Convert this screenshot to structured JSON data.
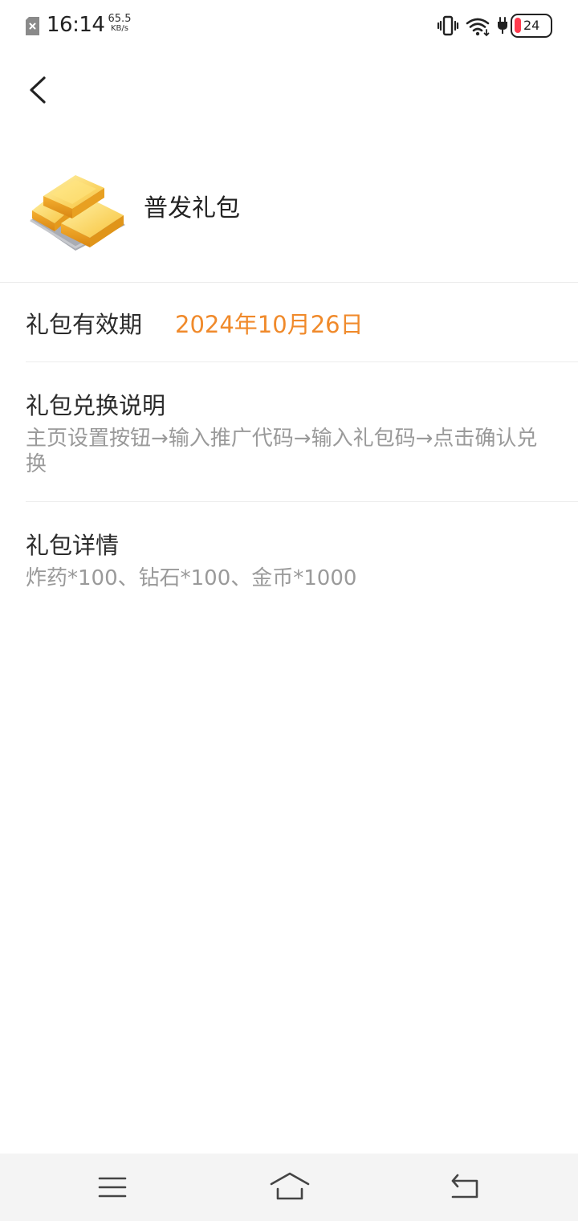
{
  "status_bar": {
    "time": "16:14",
    "net_speed_value": "65.5",
    "net_speed_unit": "KB/s",
    "battery_level": "24",
    "battery_color": "#ff3b4e"
  },
  "icons": {
    "sim": "sim-card-disabled-icon",
    "vibrate": "vibrate-icon",
    "wifi": "wifi-icon",
    "charging": "charging-plug-icon",
    "back": "chevron-left-icon",
    "gift": "gold-bars-icon",
    "nav_menu": "menu-icon",
    "nav_home": "home-icon",
    "nav_back": "return-icon"
  },
  "gift": {
    "title": "普发礼包",
    "validity_label": "礼包有效期",
    "validity_value": "2024年10月26日",
    "validity_color": "#f08a2b",
    "redeem_title": "礼包兑换说明",
    "redeem_body": "主页设置按钮→输入推广代码→输入礼包码→点击确认兑换",
    "details_title": "礼包详情",
    "details_body": "炸药*100、钻石*100、金币*1000"
  }
}
